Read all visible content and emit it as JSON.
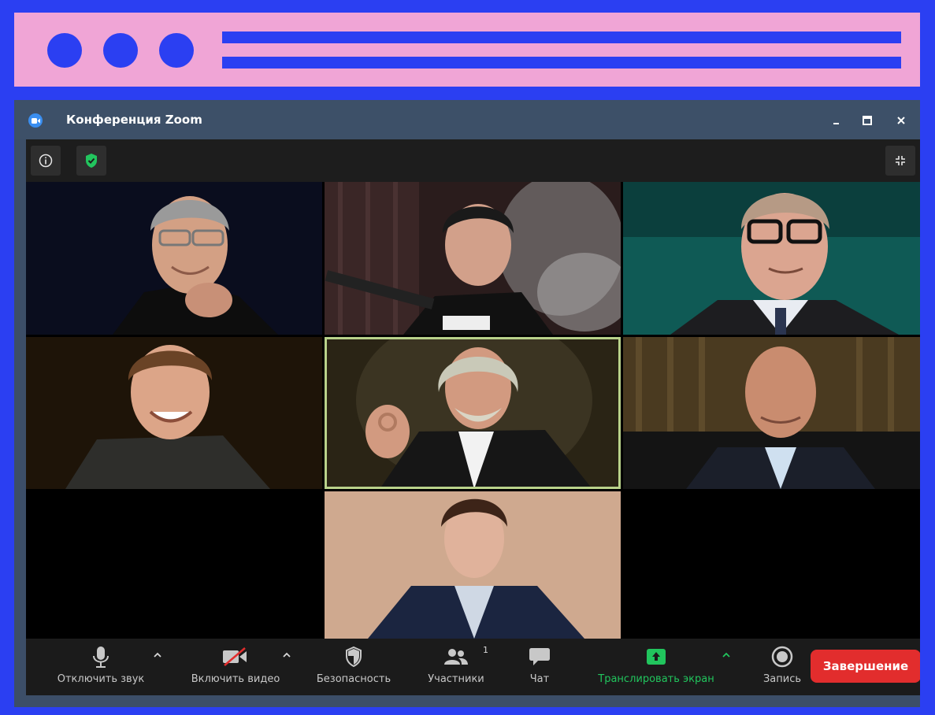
{
  "window": {
    "title": "Конференция Zoom",
    "minimize_label": "‒",
    "maximize_label": "☐",
    "close_label": "✕"
  },
  "colors": {
    "frame_blue": "#2b3ff2",
    "deco_pink": "#f0a5d6",
    "window_chrome": "#3c4e68",
    "end_red": "#e22d2d",
    "share_green": "#21c55d"
  },
  "topbar": {
    "info_icon": "info-icon",
    "security_icon": "shield-check-icon",
    "fullscreen_icon": "fullscreen-icon"
  },
  "participants": [
    {
      "tile": "participant-1",
      "active": false
    },
    {
      "tile": "participant-2",
      "active": false
    },
    {
      "tile": "participant-3",
      "active": false
    },
    {
      "tile": "participant-4",
      "active": false
    },
    {
      "tile": "participant-5",
      "active": true
    },
    {
      "tile": "participant-6",
      "active": false
    },
    {
      "tile": "participant-7",
      "active": false
    }
  ],
  "toolbar": {
    "mute_label": "Отключить звук",
    "video_label": "Включить видео",
    "security_label": "Безопасность",
    "participants_label": "Участники",
    "participants_count": "1",
    "chat_label": "Чат",
    "share_label": "Транслировать экран",
    "record_label": "Запись",
    "end_label": "Завершение"
  }
}
